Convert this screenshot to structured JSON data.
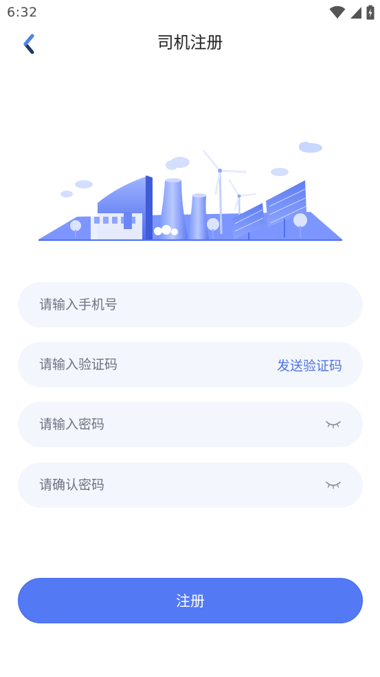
{
  "status_bar": {
    "time": "6:32",
    "icons": [
      "wifi-icon",
      "cellular-signal-icon",
      "battery-charging-icon"
    ]
  },
  "nav": {
    "back_icon": "chevron-left-icon",
    "title": "司机注册"
  },
  "illustration": {
    "icon": "energy-industry-illustration"
  },
  "form": {
    "phone": {
      "value": "",
      "placeholder": "请输入手机号"
    },
    "code": {
      "value": "",
      "placeholder": "请输入验证码",
      "send_label": "发送验证码"
    },
    "password": {
      "value": "",
      "placeholder": "请输入密码",
      "toggle_icon": "eye-closed-icon"
    },
    "confirm_password": {
      "value": "",
      "placeholder": "请确认密码",
      "toggle_icon": "eye-closed-icon"
    }
  },
  "actions": {
    "register_label": "注册"
  },
  "colors": {
    "accent": "#5479f5",
    "link": "#4f75e0",
    "field_bg": "#f3f6fc",
    "back_arrow": "#1f3a66"
  }
}
